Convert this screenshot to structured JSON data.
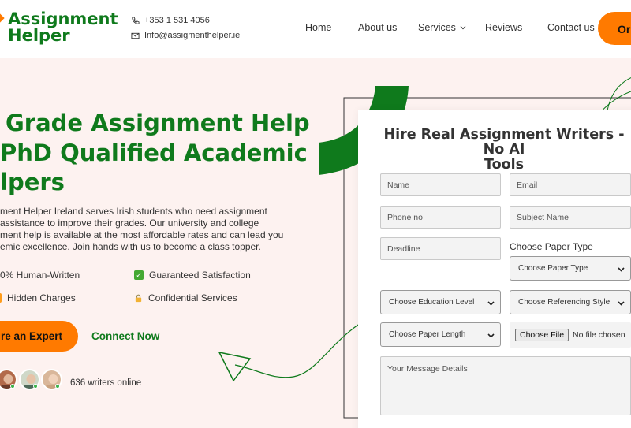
{
  "header": {
    "logo_line1": "Assignment",
    "logo_line2": "Helper",
    "phone": "+353 1 531 4056",
    "email": "Info@assigmenthelper.ie",
    "nav": [
      "Home",
      "About us",
      "Services",
      "Reviews",
      "Contact us"
    ],
    "order_label": "Or"
  },
  "hero": {
    "title_line1": "Grade Assignment Help",
    "title_line2": "PhD Qualified Academic",
    "title_line3": "lpers",
    "desc_line1": "ment Helper Ireland serves Irish students who need assignment",
    "desc_line2": "assistance to improve their grades. Our university and college",
    "desc_line3": "ment help is available at the most affordable rates and can lead you",
    "desc_line4": "emic excellence. Join hands with us to become a class topper.",
    "features": [
      "0% Human-Written",
      "Guaranteed Satisfaction",
      "Hidden Charges",
      "Confidential Services"
    ],
    "hire_label": "re an Expert",
    "connect_label": "Connect Now",
    "writers_online": "636 writers online"
  },
  "form": {
    "title_line1": "Hire Real Assignment Writers - No AI",
    "title_line2": "Tools",
    "name_placeholder": "Name",
    "email_placeholder": "Email",
    "phone_placeholder": "Phone no",
    "subject_placeholder": "Subject Name",
    "deadline_placeholder": "Deadline",
    "paper_type_label": "Choose Paper Type",
    "paper_type_select": "Choose Paper Type",
    "education_select": "Choose Education Level",
    "referencing_select": "Choose Referencing Style",
    "length_select": "Choose Paper Length",
    "file_button": "Choose File",
    "file_status": "No file chosen",
    "message_placeholder": "Your Message Details"
  },
  "colors": {
    "brand_green": "#0f7a1c",
    "accent_orange": "#ff7a00",
    "background": "#fdf2f0"
  }
}
